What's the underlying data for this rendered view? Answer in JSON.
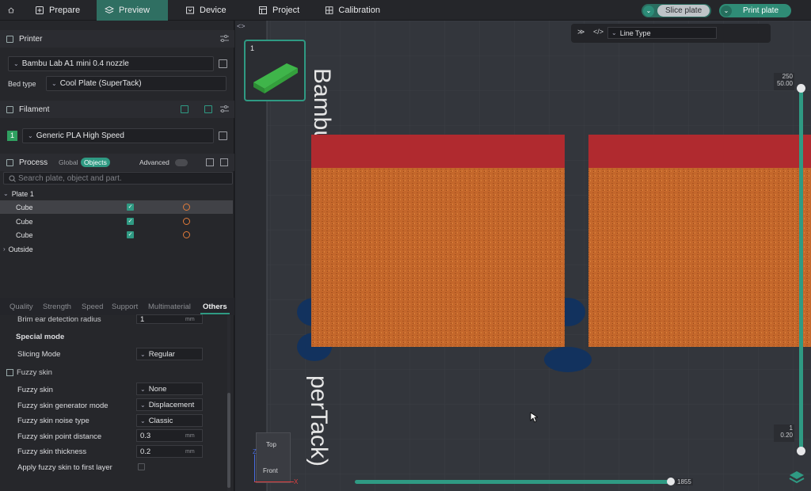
{
  "topbar": {
    "tabs": [
      {
        "label": "Prepare"
      },
      {
        "label": "Preview"
      },
      {
        "label": "Device"
      },
      {
        "label": "Project"
      },
      {
        "label": "Calibration"
      }
    ],
    "slice_label": "Slice plate",
    "print_label": "Print plate"
  },
  "printer": {
    "title": "Printer",
    "name": "Bambu Lab A1 mini 0.4 nozzle",
    "bed_type_label": "Bed type",
    "bed_type": "Cool Plate (SuperTack)"
  },
  "filament": {
    "title": "Filament",
    "slot": "1",
    "name": "Generic PLA High Speed"
  },
  "process": {
    "title": "Process",
    "global": "Global",
    "objects": "Objects",
    "advanced": "Advanced",
    "search_placeholder": "Search plate, object and part."
  },
  "tree": {
    "plate": "Plate 1",
    "items": [
      {
        "name": "Cube"
      },
      {
        "name": "Cube"
      },
      {
        "name": "Cube"
      }
    ],
    "outside": "Outside"
  },
  "settings_tabs": [
    "Quality",
    "Strength",
    "Speed",
    "Support",
    "Multimaterial",
    "Others"
  ],
  "settings": {
    "cut_row": "Brim ear detection radius",
    "cut_value": "1",
    "cut_unit": "mm",
    "special_mode": "Special mode",
    "slicing_mode_label": "Slicing Mode",
    "slicing_mode": "Regular",
    "fuzzy_title": "Fuzzy skin",
    "fuzzy_skin_label": "Fuzzy skin",
    "fuzzy_skin": "None",
    "gen_mode_label": "Fuzzy skin generator mode",
    "gen_mode": "Displacement",
    "noise_label": "Fuzzy skin noise type",
    "noise": "Classic",
    "point_dist_label": "Fuzzy skin point distance",
    "point_dist": "0.3",
    "thickness_label": "Fuzzy skin thickness",
    "thickness": "0.2",
    "unit": "mm",
    "first_layer_label": "Apply fuzzy skin to first layer"
  },
  "viewport": {
    "plate_number": "1",
    "line_type": "Line Type",
    "bed_text_top": "Bambu",
    "bed_text_bottom": "perTack)",
    "slider_top": "250",
    "slider_top_sub": "50.00",
    "slider_bottom": "1",
    "slider_bottom_sub": "0.20",
    "h_slider_value": "1855",
    "view_top": "Top",
    "view_front": "Front",
    "axis_z": "Z",
    "axis_x": "X"
  },
  "colors": {
    "accent": "#2f9a83",
    "red_top": "#b32a2e",
    "orange_body": "#c86a2a"
  }
}
